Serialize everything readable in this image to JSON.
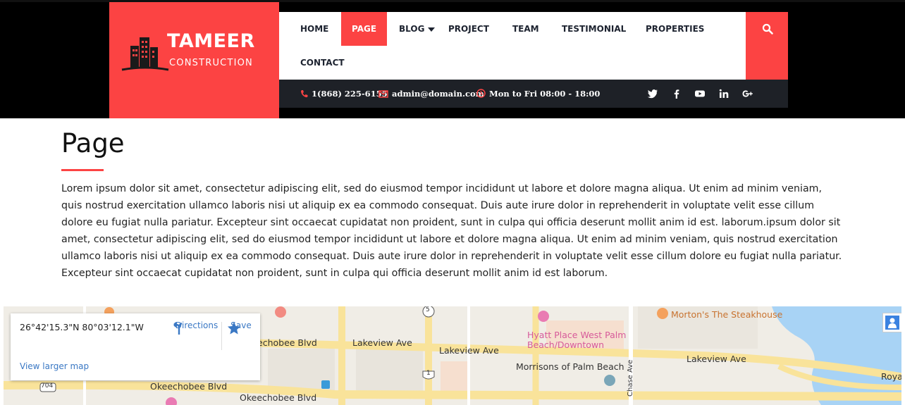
{
  "header": {
    "logo_title": "TAMEER",
    "logo_subtitle": "CONSTRUCTION",
    "nav": [
      {
        "label": "HOME"
      },
      {
        "label": "PAGE"
      },
      {
        "label": "BLOG"
      },
      {
        "label": "PROJECT"
      },
      {
        "label": "TEAM"
      },
      {
        "label": "TESTIMONIAL"
      },
      {
        "label": "PROPERTIES"
      },
      {
        "label": "CONTACT"
      }
    ],
    "active_nav": "PAGE",
    "phone": "1(868) 225-6155",
    "email": "admin@domain.com",
    "hours": "Mon to Fri 08:00 - 18:00",
    "social_icons": [
      "twitter-icon",
      "facebook-icon",
      "youtube-icon",
      "linkedin-icon",
      "google-plus-icon"
    ],
    "colors": {
      "accent": "#fc4343",
      "dark": "#1e2127"
    }
  },
  "content": {
    "title": "Page",
    "body": "Lorem ipsum dolor sit amet, consectetur adipiscing elit, sed do eiusmod tempor incididunt ut labore et dolore magna aliqua. Ut enim ad minim veniam, quis nostrud exercitation ullamco laboris nisi ut aliquip ex ea commodo consequat. Duis aute irure dolor in reprehenderit in voluptate velit esse cillum dolore eu fugiat nulla pariatur. Excepteur sint occaecat cupidatat non proident, sunt in culpa qui officia deserunt mollit anim id est. laborum.ipsum dolor sit amet, consectetur adipiscing elit, sed do eiusmod tempor incididunt ut labore et dolore magna aliqua. Ut enim ad minim veniam, quis nostrud exercitation ullamco laboris nisi ut aliquip ex ea commodo consequat. Duis aute irure dolor in reprehenderit in voluptate velit esse cillum dolore eu fugiat nulla pariatur. Excepteur sint occaecat cupidatat non proident, sunt in culpa qui officia deserunt mollit anim id est laborum."
  },
  "map": {
    "coordinates": "26°42'15.3\"N 80°03'12.1\"W",
    "directions_label": "Directions",
    "save_label": "Save",
    "larger_map_label": "View larger map",
    "labels": {
      "lakeview_1": "Lakeview Ave",
      "lakeview_2": "Lakeview Ave",
      "lakeview_3": "Lakeview Ave",
      "okeechobee_1": "echobee Blvd",
      "okeechobee_2": "Okeechobee Blvd",
      "okeechobee_3": "Okeechobee Blvd",
      "hyatt": "Hyatt Place West Palm Beach/Downtown",
      "mortons": "Morton's The Steakhouse",
      "morrisons": "Morrisons of Palm Beach",
      "chase": "Chase Ave",
      "royal": "Roya",
      "route_5": "5",
      "route_1": "1",
      "route_704": "704"
    }
  }
}
